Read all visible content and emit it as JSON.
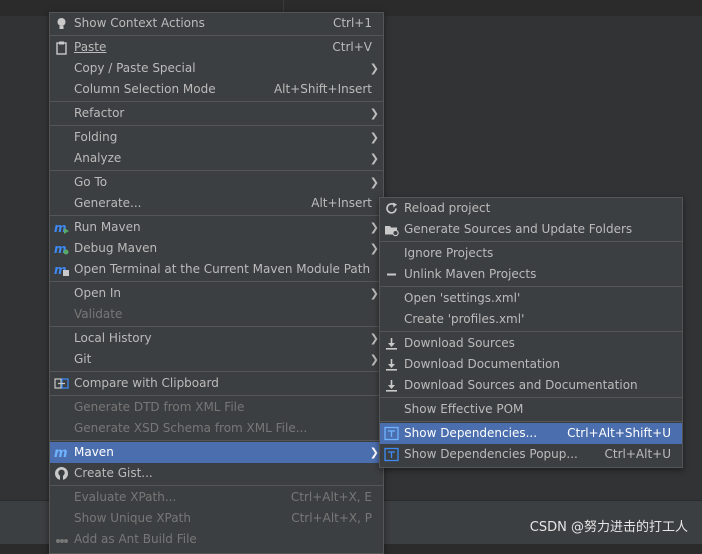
{
  "main_menu": {
    "show_context_actions": {
      "label": "Show Context Actions",
      "shortcut": "Ctrl+1"
    },
    "paste": {
      "label": "Paste",
      "shortcut": "Ctrl+V"
    },
    "copy_paste_special": {
      "label": "Copy / Paste Special"
    },
    "column_selection_mode": {
      "label": "Column Selection Mode",
      "shortcut": "Alt+Shift+Insert"
    },
    "refactor": {
      "label": "Refactor"
    },
    "folding": {
      "label": "Folding"
    },
    "analyze": {
      "label": "Analyze"
    },
    "go_to": {
      "label": "Go To"
    },
    "generate": {
      "label": "Generate...",
      "shortcut": "Alt+Insert"
    },
    "run_maven": {
      "label": "Run Maven"
    },
    "debug_maven": {
      "label": "Debug Maven"
    },
    "open_terminal": {
      "label": "Open Terminal at the Current Maven Module Path"
    },
    "open_in": {
      "label": "Open In"
    },
    "validate": {
      "label": "Validate"
    },
    "local_history": {
      "label": "Local History"
    },
    "git": {
      "label": "Git"
    },
    "compare_clipboard": {
      "label": "Compare with Clipboard"
    },
    "generate_dtd": {
      "label": "Generate DTD from XML File"
    },
    "generate_xsd": {
      "label": "Generate XSD Schema from XML File..."
    },
    "maven": {
      "label": "Maven"
    },
    "create_gist": {
      "label": "Create Gist..."
    },
    "evaluate_xpath": {
      "label": "Evaluate XPath...",
      "shortcut": "Ctrl+Alt+X, E"
    },
    "show_unique_xpath": {
      "label": "Show Unique XPath",
      "shortcut": "Ctrl+Alt+X, P"
    },
    "add_ant_build": {
      "label": "Add as Ant Build File"
    }
  },
  "maven_submenu": {
    "reload_project": {
      "label": "Reload project"
    },
    "generate_sources": {
      "label": "Generate Sources and Update Folders"
    },
    "ignore_projects": {
      "label": "Ignore Projects"
    },
    "unlink_projects": {
      "label": "Unlink Maven Projects"
    },
    "open_settings": {
      "label": "Open 'settings.xml'"
    },
    "create_profiles": {
      "label": "Create 'profiles.xml'"
    },
    "download_sources": {
      "label": "Download Sources"
    },
    "download_docs": {
      "label": "Download Documentation"
    },
    "download_both": {
      "label": "Download Sources and Documentation"
    },
    "show_effective_pom": {
      "label": "Show Effective POM"
    },
    "show_dependencies": {
      "label": "Show Dependencies...",
      "shortcut": "Ctrl+Alt+Shift+U"
    },
    "show_dependencies_popup": {
      "label": "Show Dependencies Popup...",
      "shortcut": "Ctrl+Alt+U"
    }
  },
  "watermark": "CSDN @努力进击的打工人",
  "colors": {
    "menu_bg": "#3c3f41",
    "selected_bg": "#4b6eaf",
    "text": "#bbbbbb",
    "disabled_text": "#777777",
    "maven_icon": "#3d8af7"
  }
}
